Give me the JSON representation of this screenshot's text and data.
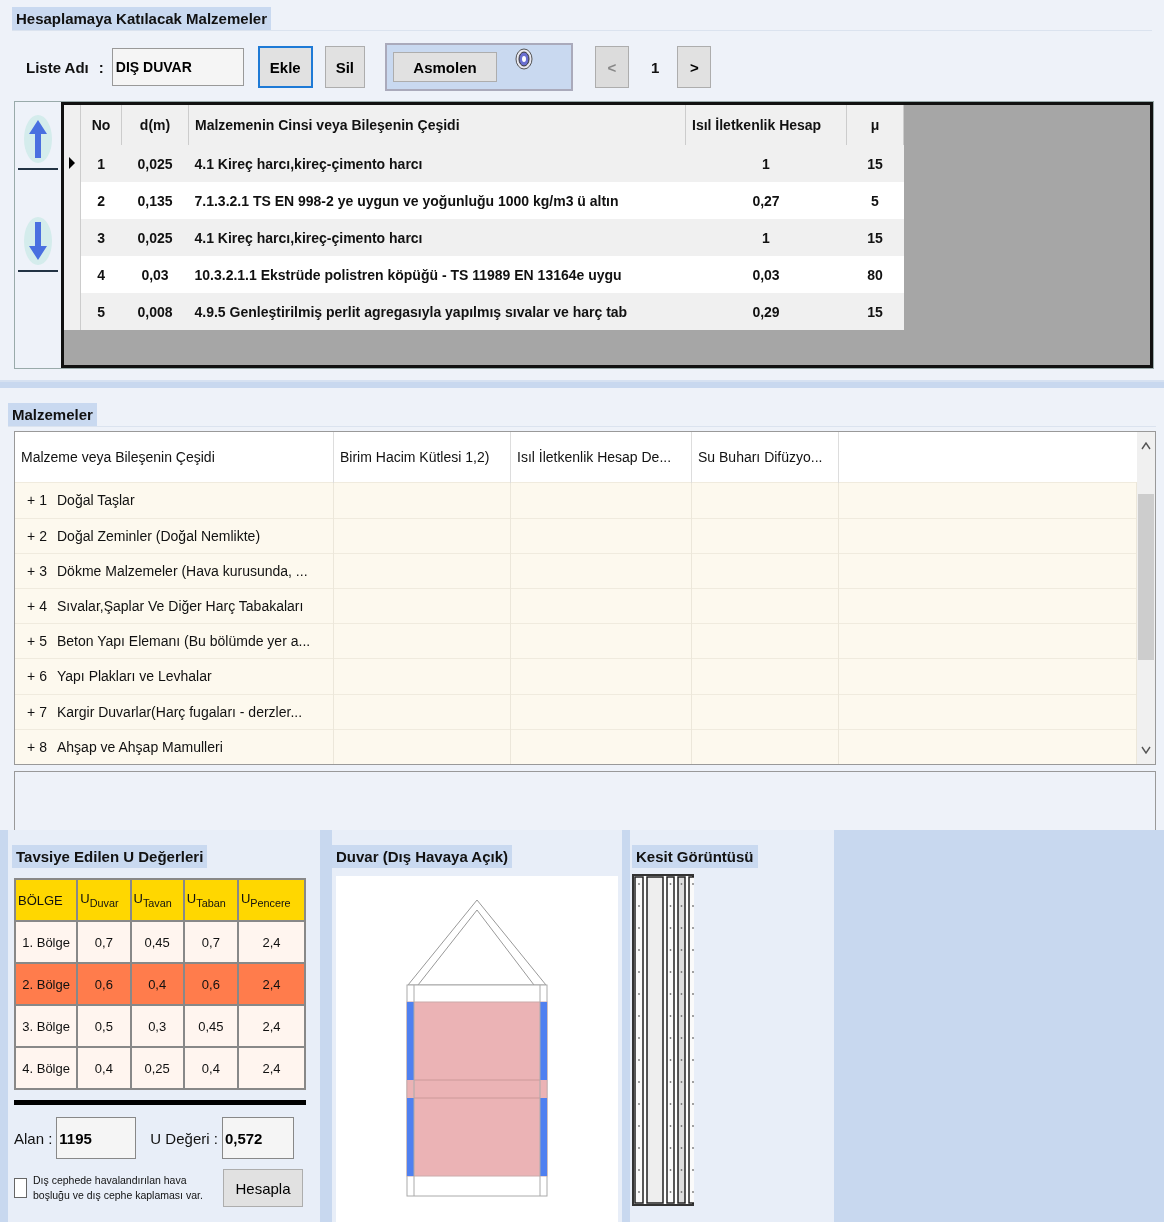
{
  "layers_panel": {
    "title": "Hesaplamaya Katılacak Malzemeler",
    "list_name": {
      "label": "Liste Adı",
      "separator": ":",
      "value": "DIŞ DUVAR"
    },
    "buttons": [
      {
        "label": "Ekle",
        "focused": true
      },
      {
        "label": "Sil",
        "focused": false
      }
    ],
    "material_toggle": {
      "label": "Asmolen"
    },
    "pager": {
      "prev": {
        "label": "<",
        "disabled": true
      },
      "page": "1",
      "next": {
        "label": ">",
        "disabled": false
      }
    },
    "columns": [
      "No",
      "d(m)",
      "Malzemenin Cinsi veya Bileşenin Çeşidi",
      "Isıl İletkenlik Hesap",
      "μ"
    ],
    "rows": [
      {
        "current": true,
        "cells": [
          "1",
          "0,025",
          "4.1   Kireç harcı,kireç-çimento harcı",
          "1",
          "15"
        ]
      },
      {
        "current": false,
        "cells": [
          "2",
          "0,135",
          "7.1.3.2.1   TS EN 998-2 ye uygun ve yoğunluğu 1000 kg/m3 ü altın",
          "0,27",
          "5"
        ]
      },
      {
        "current": false,
        "cells": [
          "3",
          "0,025",
          "4.1   Kireç harcı,kireç-çimento harcı",
          "1",
          "15"
        ]
      },
      {
        "current": false,
        "cells": [
          "4",
          "0,03",
          "10.3.2.1.1   Ekstrüde polistren köpüğü - TS 11989 EN 13164e uygu",
          "0,03",
          "80"
        ]
      },
      {
        "current": false,
        "cells": [
          "5",
          "0,008",
          "4.9.5   Genleştirilmiş perlit agregasıyla yapılmış sıvalar ve harç tab",
          "0,29",
          "15"
        ]
      }
    ]
  },
  "materials_panel": {
    "title": "Malzemeler",
    "columns": [
      "Malzeme veya Bileşenin Çeşidi",
      "Birim Hacim Kütlesi 1,2)",
      "Isıl İletkenlik Hesap De...",
      "Su Buharı Difüzyo..."
    ],
    "rows": [
      {
        "expander": "+",
        "number": "1",
        "name": "Doğal Taşlar"
      },
      {
        "expander": "+",
        "number": "2",
        "name": "Doğal Zeminler (Doğal Nemlikte)"
      },
      {
        "expander": "+",
        "number": "3",
        "name": "Dökme Malzemeler (Hava kurusunda, ..."
      },
      {
        "expander": "+",
        "number": "4",
        "name": "Sıvalar,Şaplar Ve Diğer Harç Tabakaları"
      },
      {
        "expander": "+",
        "number": "5",
        "name": "Beton Yapı Elemanı (Bu bölümde yer a..."
      },
      {
        "expander": "+",
        "number": "6",
        "name": "Yapı Plakları ve Levhalar"
      },
      {
        "expander": "+",
        "number": "7",
        "name": "Kargir Duvarlar(Harç fugaları - derzler..."
      },
      {
        "expander": "+",
        "number": "8",
        "name": "Ahşap ve Ahşap Mamulleri"
      }
    ]
  },
  "u_values_panel": {
    "title": "Tavsiye Edilen U Değerleri",
    "columns": [
      "BÖLGE",
      "U$_{Duvar}$",
      "U$_{Tavan}$",
      "U$_{Taban}$",
      "U$_{Pencere}$"
    ],
    "rows": [
      {
        "selected": false,
        "cells": [
          "1. Bölge",
          "0,7",
          "0,45",
          "0,7",
          "2,4"
        ]
      },
      {
        "selected": true,
        "cells": [
          "2. Bölge",
          "0,6",
          "0,4",
          "0,6",
          "2,4"
        ]
      },
      {
        "selected": false,
        "cells": [
          "3. Bölge",
          "0,5",
          "0,3",
          "0,45",
          "2,4"
        ]
      },
      {
        "selected": false,
        "cells": [
          "4. Bölge",
          "0,4",
          "0,25",
          "0,4",
          "2,4"
        ]
      }
    ],
    "area": {
      "label": "Alan :",
      "value": "1195"
    },
    "u_value": {
      "label": "U Değeri  :",
      "value": "0,572"
    },
    "ventilated": {
      "label": "Dış cephede havalandırılan hava boşluğu ve dış cephe kaplaması var.",
      "checked": false
    },
    "calculate_button": "Hesapla"
  },
  "wall_panel": {
    "title": "Duvar (Dış Havaya Açık)"
  },
  "section_panel": {
    "title": "Kesit Görüntüsü"
  }
}
